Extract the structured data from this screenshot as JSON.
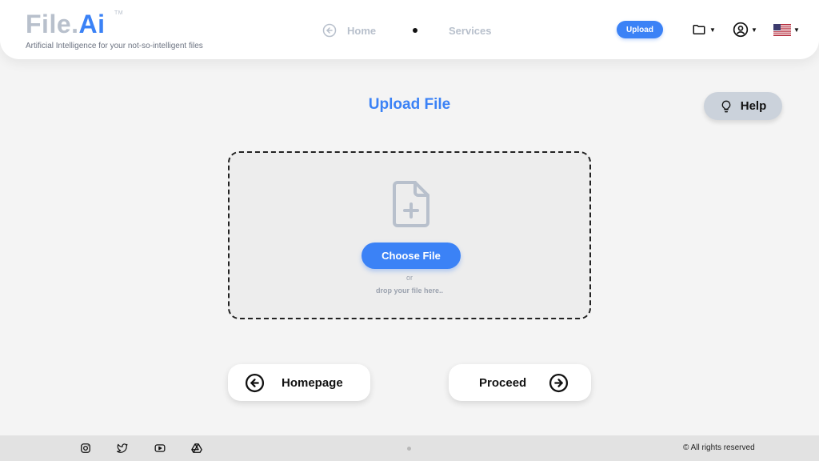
{
  "brand": {
    "name_part1": "File.",
    "name_part2": "Ai",
    "trademark": "TM",
    "tagline": "Artificial Intelligence for your not-so-intelligent files"
  },
  "nav": {
    "home_label": "Home",
    "services_label": "Services",
    "upload_label": "Upload"
  },
  "header_icons": [
    "folder-icon",
    "user-circle-icon",
    "us-flag-icon"
  ],
  "main": {
    "title": "Upload File",
    "help_label": "Help",
    "choose_file_label": "Choose File",
    "or_text": "or",
    "drop_text": "drop your file here..",
    "homepage_label": "Homepage",
    "proceed_label": "Proceed"
  },
  "footer": {
    "social_icons": [
      "instagram-icon",
      "twitter-icon",
      "youtube-icon",
      "google-drive-icon"
    ],
    "rights": "© All rights reserved"
  },
  "colors": {
    "accent": "#3b82f6",
    "muted": "#b8c0cc",
    "background": "#f4f4f4",
    "footer": "#e2e2e2"
  }
}
